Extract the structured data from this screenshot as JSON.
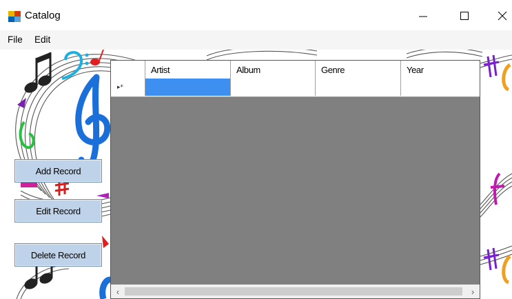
{
  "window": {
    "title": "Catalog",
    "icons": {
      "app": "app-icon",
      "minimize": "minimize-icon",
      "maximize": "maximize-icon",
      "close": "close-icon"
    }
  },
  "menu": {
    "items": [
      "File",
      "Edit"
    ]
  },
  "buttons": {
    "add": "Add Record",
    "edit": "Edit Record",
    "delete": "Delete Record"
  },
  "grid": {
    "columns": [
      "Artist",
      "Album",
      "Genre",
      "Year"
    ],
    "rows": [
      [
        "",
        "",
        "",
        ""
      ]
    ],
    "new_row_marker": "▸*",
    "selected_cell": {
      "row": 0,
      "column": "Artist"
    },
    "scroll_left": "‹",
    "scroll_right": "›"
  },
  "colors": {
    "selection": "#3d8ff0",
    "button_face": "#bed3ea",
    "grid_background": "#808080"
  }
}
